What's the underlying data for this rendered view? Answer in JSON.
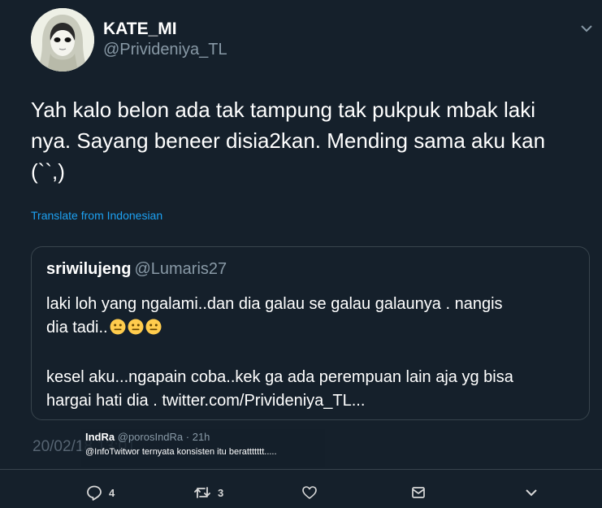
{
  "author": {
    "display_name": "KATE_MI",
    "handle": "@Privideniya_TL"
  },
  "tweet": {
    "lines": [
      "Yah kalo belon ada tak tampung tak pukpuk mbak laki",
      "nya. Sayang beneer disia2kan. Mending sama aku kan",
      "(``,)"
    ],
    "translate_label": "Translate from Indonesian",
    "timestamp": "20/02/18 13:01"
  },
  "quoted": {
    "display_name": "sriwilujeng",
    "handle": "@Lumaris27",
    "para1_line1": "laki loh yang ngalami..dan dia galau se galau galaunya . nangis",
    "para1_line2": "dia tadi..",
    "para2_line1": "kesel aku...ngapain coba..kek ga ada perempuan lain aja yg bisa",
    "para2_line2": "hargai hati dia . twitter.com/Privideniya_TL..."
  },
  "overlay_reply": {
    "name": "IndRa",
    "handle": "@porosIndRa",
    "time": "· 21h",
    "text": "@InfoTwitwor ternyata konsisten itu berattttttt....."
  },
  "actions": {
    "replies": "4",
    "retweets": "3"
  },
  "icons": {
    "menu": "chevron-down-icon",
    "reply": "reply-icon",
    "retweet": "retweet-icon",
    "like": "heart-icon",
    "dm": "envelope-icon",
    "more": "chevron-down-icon",
    "emoji": "neutral-face-emoji"
  },
  "colors": {
    "background": "#15202b",
    "accent": "#1da1f2",
    "muted": "#8899a6",
    "border": "#38444d"
  }
}
